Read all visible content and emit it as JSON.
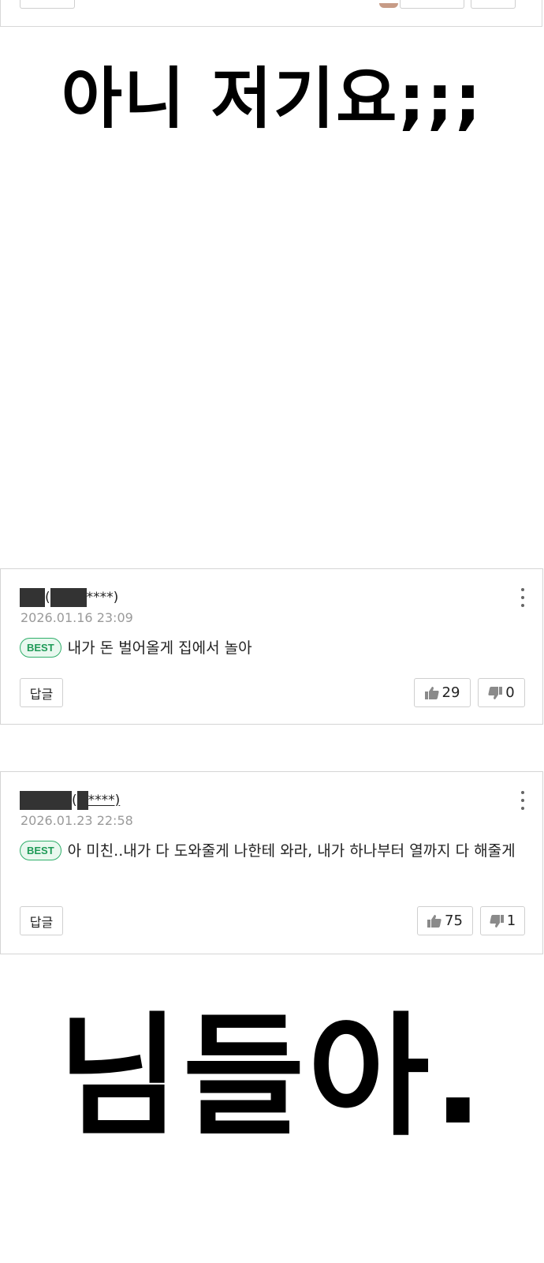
{
  "captions": {
    "top": "아니 저기요;;;",
    "bottom": "님들아."
  },
  "comments": [
    {
      "author_mask_suffix": "****)",
      "author_open": "(",
      "date": "2026.01.16 23:09",
      "badge": "BEST",
      "text": "내가 돈 벌어올게 집에서 놀아",
      "reply_label": "답글",
      "likes": "29",
      "dislikes": "0"
    },
    {
      "author_mask_suffix": "****)",
      "author_open": "(",
      "date": "2026.01.23 22:58",
      "badge": "BEST",
      "text": "아 미친..내가 다 도와줄게 나한테 와라, 내가 하나부터 열까지 다 해줄게",
      "reply_label": "답글",
      "likes": "75",
      "dislikes": "1"
    }
  ],
  "icons": {
    "like": "thumbs-up-icon",
    "dislike": "thumbs-down-icon",
    "more": "more-vertical-icon"
  }
}
